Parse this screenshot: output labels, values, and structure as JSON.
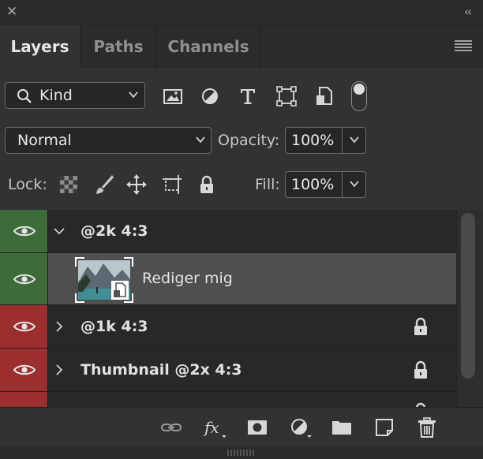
{
  "tabs": [
    {
      "label": "Layers",
      "active": true
    },
    {
      "label": "Paths",
      "active": false
    },
    {
      "label": "Channels",
      "active": false
    }
  ],
  "filter": {
    "value": "Kind",
    "icons": [
      "image-filter-icon",
      "adjustment-filter-icon",
      "type-filter-icon",
      "shape-filter-icon",
      "smart-object-filter-icon"
    ]
  },
  "blend": {
    "mode": "Normal"
  },
  "opacity": {
    "label": "Opacity:",
    "value": "100%"
  },
  "lock": {
    "label": "Lock:",
    "icons": [
      "lock-transparent-pixels-icon",
      "lock-image-pixels-icon",
      "lock-position-icon",
      "lock-artboard-icon",
      "lock-all-icon"
    ]
  },
  "fill": {
    "label": "Fill:",
    "value": "100%"
  },
  "layers": [
    {
      "name": "@2k 4:3",
      "type": "group",
      "expanded": true,
      "visible": true,
      "color": "#3d6b3a",
      "locked": false
    },
    {
      "name": "Rediger mig",
      "type": "smart-object",
      "visible": true,
      "color": "#3d6b3a",
      "locked": false,
      "selected": true
    },
    {
      "name": "@1k 4:3",
      "type": "group",
      "expanded": false,
      "visible": true,
      "color": "#9b2f2f",
      "locked": true
    },
    {
      "name": "Thumbnail @2x 4:3",
      "type": "group",
      "expanded": false,
      "visible": true,
      "color": "#9b2f2f",
      "locked": true
    },
    {
      "name": "",
      "type": "group",
      "expanded": false,
      "visible": true,
      "color": "#9b2f2f",
      "locked": true
    }
  ],
  "bottom_icons": [
    "link-layers-icon",
    "fx-icon",
    "add-mask-icon",
    "adjustment-layer-icon",
    "new-group-icon",
    "new-layer-icon",
    "delete-icon"
  ],
  "colors": {
    "panel": "#323232",
    "group_label_green": "#3d6b3a",
    "group_label_red": "#9b2f2f",
    "selected_row": "#4f4f4f"
  }
}
